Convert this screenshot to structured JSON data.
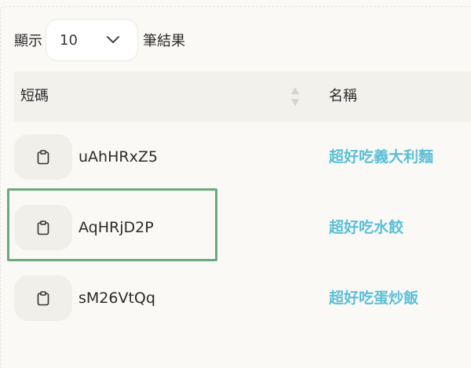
{
  "length_control": {
    "prefix": "顯示",
    "selected": "10",
    "suffix": "筆結果"
  },
  "table": {
    "headers": {
      "code": "短碼",
      "name": "名稱"
    },
    "rows": [
      {
        "code": "uAhHRxZ5",
        "name": "超好吃義大利麵"
      },
      {
        "code": "AqHRjD2P",
        "name": "超好吃水餃"
      },
      {
        "code": "sM26VtQq",
        "name": "超好吃蛋炒飯"
      }
    ]
  },
  "colors": {
    "link": "#5bbfd6",
    "highlight": "#6aa97d",
    "header_bg": "#f2f1ec"
  }
}
